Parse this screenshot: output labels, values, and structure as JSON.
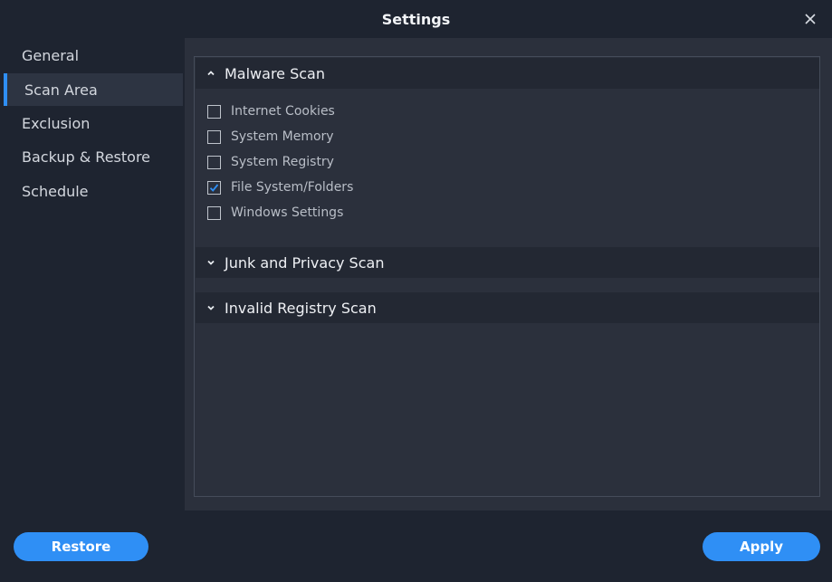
{
  "window": {
    "title": "Settings"
  },
  "sidebar": {
    "items": [
      {
        "label": "General",
        "active": false
      },
      {
        "label": "Scan Area",
        "active": true
      },
      {
        "label": "Exclusion",
        "active": false
      },
      {
        "label": "Backup & Restore",
        "active": false
      },
      {
        "label": "Schedule",
        "active": false
      }
    ]
  },
  "sections": [
    {
      "title": "Malware Scan",
      "expanded": true,
      "options": [
        {
          "label": "Internet Cookies",
          "checked": false
        },
        {
          "label": "System Memory",
          "checked": false
        },
        {
          "label": "System Registry",
          "checked": false
        },
        {
          "label": "File System/Folders",
          "checked": true
        },
        {
          "label": "Windows Settings",
          "checked": false
        }
      ]
    },
    {
      "title": "Junk and Privacy Scan",
      "expanded": false
    },
    {
      "title": "Invalid Registry Scan",
      "expanded": false
    }
  ],
  "footer": {
    "restore_label": "Restore",
    "apply_label": "Apply"
  },
  "colors": {
    "accent": "#2f8ff5",
    "background": "#1e2430",
    "panel": "#2b303c",
    "header": "#232833"
  },
  "icons": {
    "close": "close-icon",
    "collapse": "chevron-up-icon",
    "expand": "chevron-down-icon",
    "check": "checkmark-icon"
  }
}
